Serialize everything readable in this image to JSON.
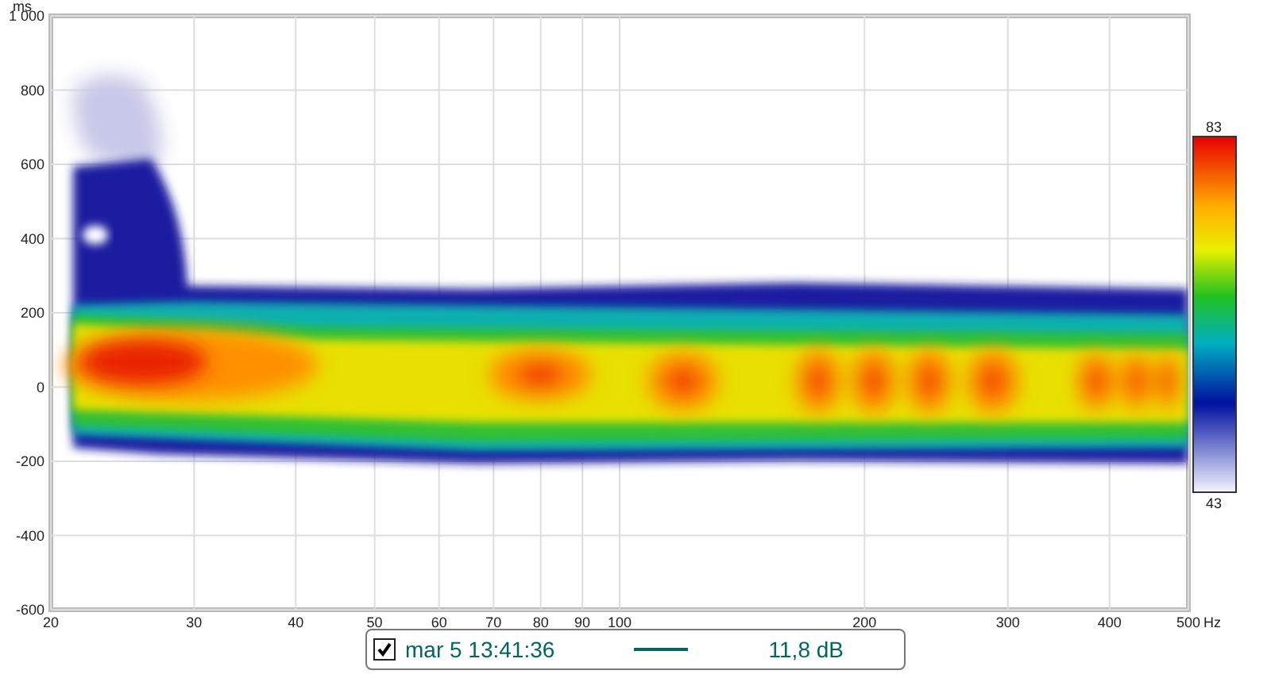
{
  "chart": {
    "y_unit": "ms",
    "x_unit": "Hz",
    "y_ticks": [
      "1 000",
      "800",
      "600",
      "400",
      "200",
      "0",
      "-200",
      "-400",
      "-600"
    ],
    "x_ticks": [
      "20",
      "30",
      "40",
      "50",
      "60",
      "70",
      "80",
      "90",
      "100",
      "200",
      "300",
      "400",
      "500"
    ]
  },
  "color_scale": {
    "max": "83",
    "min": "43"
  },
  "legend": [
    {
      "checked": true,
      "label": "mar 5 13:41:36",
      "color": "#006660",
      "value": "11,8 dB"
    }
  ]
}
